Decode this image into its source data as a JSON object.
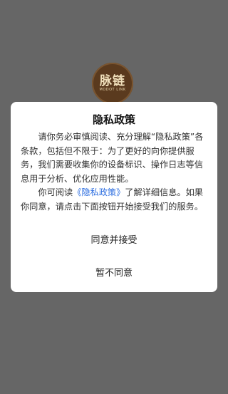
{
  "logo": {
    "main_text": "脉链",
    "sub_text": "MODOT LINK"
  },
  "dialog": {
    "title": "隐私政策",
    "paragraph1": "请你务必审慎阅读、充分理解“隐私政策”各条款，包括但不限于：为了更好的向你提供服务，我们需要收集你的设备标识、操作日志等信息用于分析、优化应用性能。",
    "paragraph2_before": "你可阅读",
    "paragraph2_link": "《隐私政策》",
    "paragraph2_after": "了解详细信息。如果你同意，请点击下面按钮开始接受我们的服务。",
    "agree_label": "同意并接受",
    "disagree_label": "暂不同意"
  },
  "colors": {
    "overlay": "#666666",
    "link": "#2d6ee0",
    "logo_bg": "#5a3a1e"
  }
}
